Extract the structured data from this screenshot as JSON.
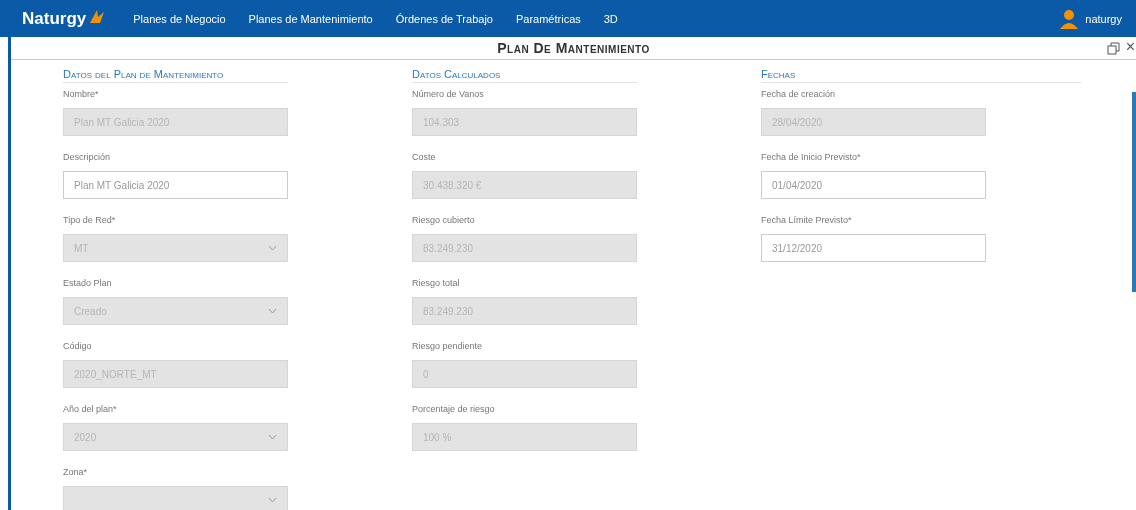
{
  "nav": {
    "brand": "Naturgy",
    "items": [
      {
        "label": "Planes de Negocio"
      },
      {
        "label": "Planes de Mantenimiento"
      },
      {
        "label": "Órdenes de Trabajo"
      },
      {
        "label": "Paramétricas"
      },
      {
        "label": "3D"
      }
    ],
    "user": "naturgy"
  },
  "panel": {
    "title": "Plan De Mantenimiento",
    "close": "×"
  },
  "sections": [
    {
      "title": "Datos del Plan de Mantenimiento",
      "fields": [
        {
          "label": "Nombre*",
          "kind": "input",
          "value": "Plan MT Galicia 2020",
          "disabled": true
        },
        {
          "label": "Descripción",
          "kind": "input",
          "value": "Plan MT Galicia 2020",
          "disabled": false
        },
        {
          "label": "Tipo de Red*",
          "kind": "select",
          "value": "MT",
          "disabled": true
        },
        {
          "label": "Estado Plan",
          "kind": "select",
          "value": "Creado",
          "disabled": true
        },
        {
          "label": "Código",
          "kind": "input",
          "value": "2020_NORTE_MT",
          "disabled": true
        },
        {
          "label": "Año del plan*",
          "kind": "select",
          "value": "2020",
          "disabled": true
        },
        {
          "label": "Zona*",
          "kind": "select",
          "disabled": true
        }
      ]
    },
    {
      "title": "Datos Calculados",
      "fields": [
        {
          "label": "Número de Vanos",
          "kind": "input",
          "value": "104.303",
          "disabled": true
        },
        {
          "label": "Coste",
          "kind": "input",
          "value": "30.438.320 €",
          "disabled": true
        },
        {
          "label": "Riesgo cubierto",
          "kind": "input",
          "value": "83.249.230",
          "disabled": true
        },
        {
          "label": "Riesgo total",
          "kind": "input",
          "value": "83.249.230",
          "disabled": true
        },
        {
          "label": "Riesgo pendiente",
          "kind": "input",
          "value": "0",
          "disabled": true
        },
        {
          "label": "Porcentaje de riesgo",
          "kind": "input",
          "value": "100 %",
          "disabled": true
        }
      ]
    },
    {
      "title": "Fechas",
      "fields": [
        {
          "label": "Fecha de creación",
          "kind": "input",
          "value": "28/04/2020",
          "disabled": true
        },
        {
          "label": "Fecha de Inicio Previsto*",
          "kind": "input",
          "value": "01/04/2020",
          "disabled": false
        },
        {
          "label": "Fecha Límite Previsto*",
          "kind": "input",
          "value": "31/12/2020",
          "disabled": false
        }
      ]
    }
  ]
}
